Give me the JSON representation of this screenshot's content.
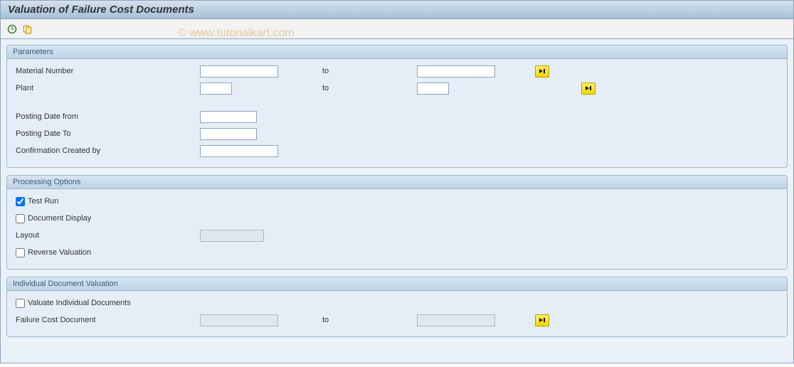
{
  "title": "Valuation of Failure Cost Documents",
  "watermark": "© www.tutorialkart.com",
  "groups": {
    "parameters": {
      "title": "Parameters",
      "material_label": "Material Number",
      "material_from": "",
      "material_to": "",
      "plant_label": "Plant",
      "plant_from": "",
      "plant_to": "",
      "to_label": "to",
      "posting_from_label": "Posting Date from",
      "posting_from": "",
      "posting_to_label": "Posting Date To",
      "posting_to": "",
      "created_by_label": "Confirmation Created by",
      "created_by": ""
    },
    "processing": {
      "title": "Processing Options",
      "test_run_label": "Test Run",
      "test_run_checked": true,
      "doc_display_label": "Document Display",
      "doc_display_checked": false,
      "layout_label": "Layout",
      "layout": "",
      "reverse_label": "Reverse Valuation",
      "reverse_checked": false
    },
    "individual": {
      "title": "Individual Document Valuation",
      "valuate_label": "Valuate Individual Documents",
      "valuate_checked": false,
      "doc_label": "Failure Cost Document",
      "doc_from": "",
      "doc_to": "",
      "to_label": "to"
    }
  }
}
